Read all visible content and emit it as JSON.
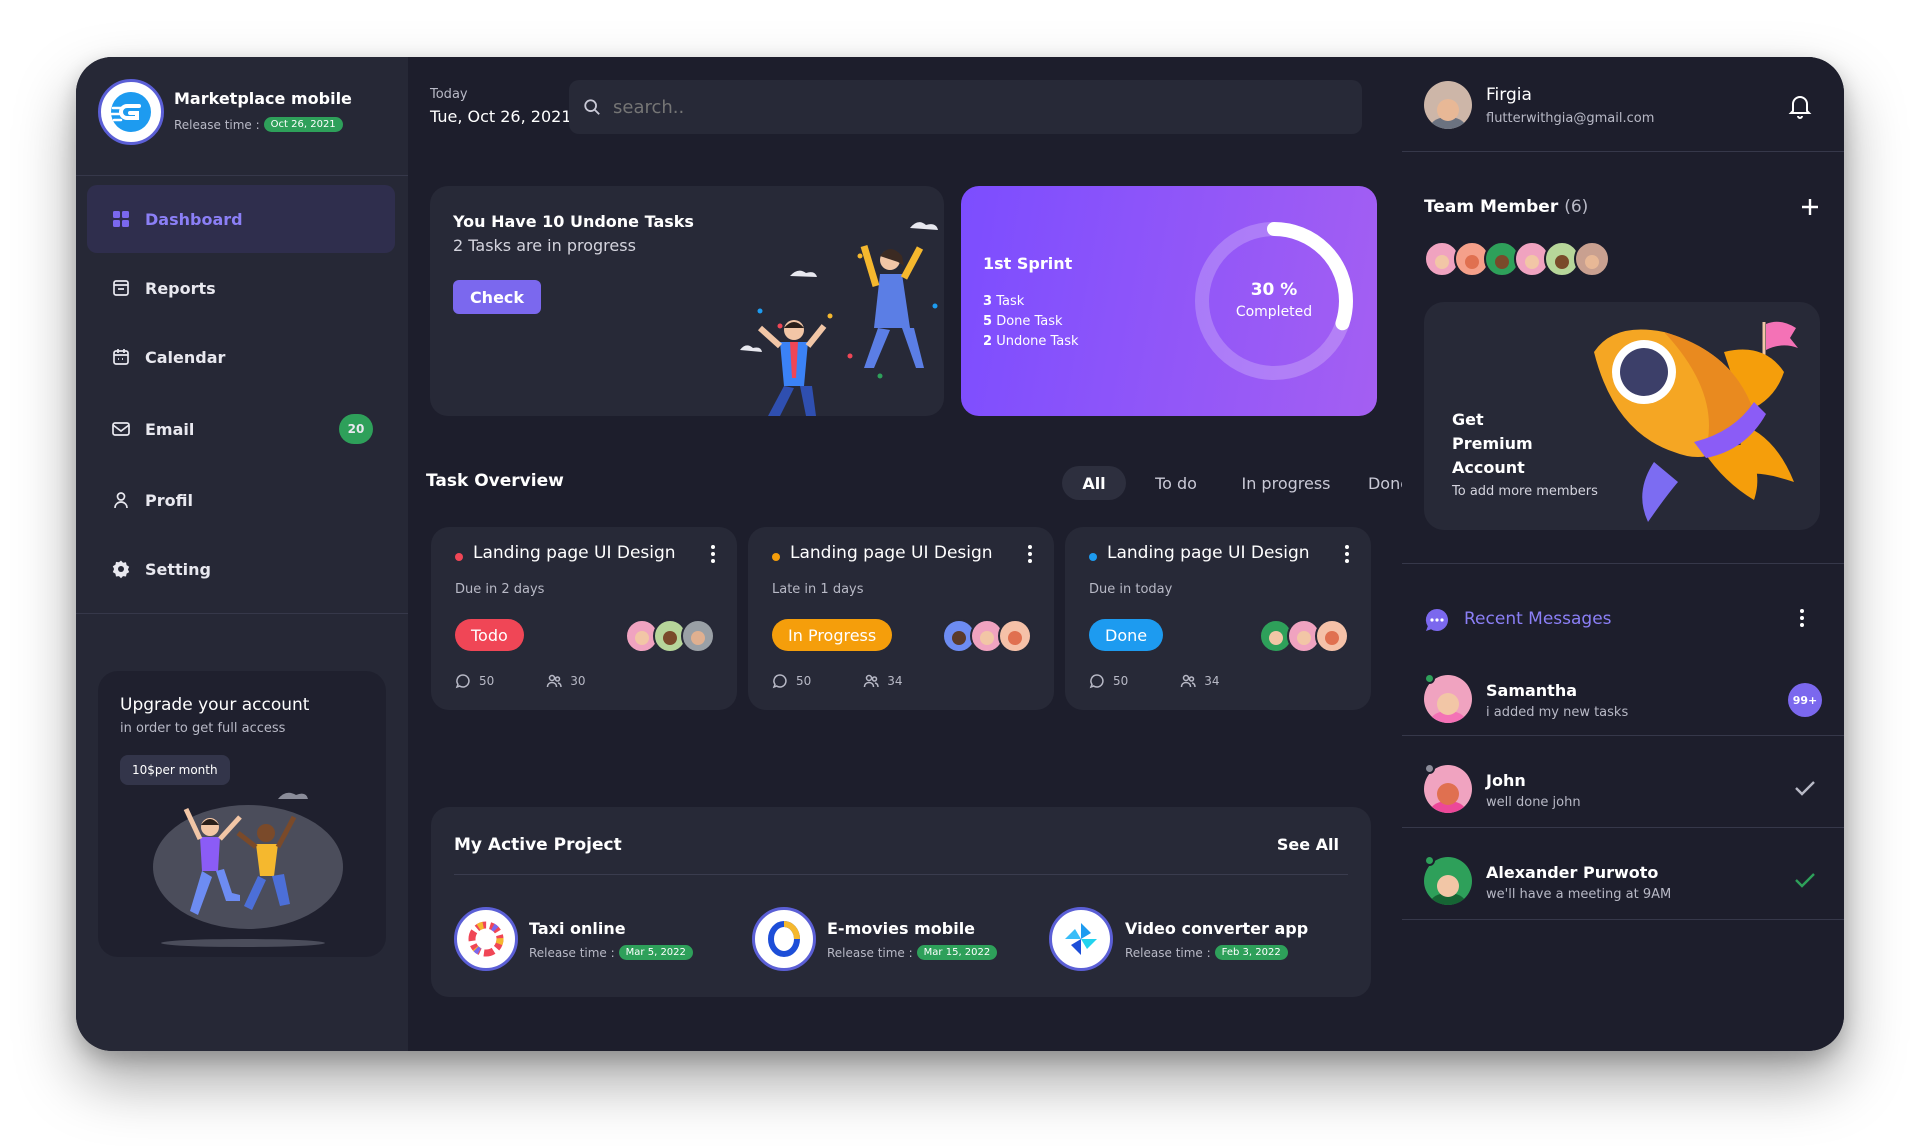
{
  "project": {
    "name": "Marketplace mobile",
    "release_label": "Release time :",
    "release_date": "Oct 26, 2021"
  },
  "nav": [
    {
      "label": "Dashboard",
      "icon": "grid-icon",
      "active": true
    },
    {
      "label": "Reports",
      "icon": "report-icon"
    },
    {
      "label": "Calendar",
      "icon": "calendar-icon"
    },
    {
      "label": "Email",
      "icon": "mail-icon",
      "badge": "20"
    },
    {
      "label": "Profil",
      "icon": "user-icon"
    },
    {
      "label": "Setting",
      "icon": "gear-icon"
    }
  ],
  "upgrade": {
    "title": "Upgrade your account",
    "subtitle": "in order to get full access",
    "price": "10$per month"
  },
  "header": {
    "today_label": "Today",
    "date": "Tue, Oct 26, 2021",
    "search_placeholder": "search.."
  },
  "tasks_banner": {
    "title": "You Have 10 Undone Tasks",
    "subtitle": "2 Tasks are in progress",
    "button": "Check"
  },
  "sprint": {
    "title": "1st Sprint",
    "tasks": [
      {
        "n": "3",
        "label": "Task"
      },
      {
        "n": "5",
        "label": "Done Task"
      },
      {
        "n": "2",
        "label": "Undone Task"
      }
    ],
    "percent": "30 %",
    "percent_value": 30,
    "completed_label": "Completed"
  },
  "overview": {
    "title": "Task Overview",
    "tabs": [
      "All",
      "To do",
      "In progress",
      "Done"
    ],
    "cards": [
      {
        "title": "Landing page UI Design",
        "due": "Due in 2 days",
        "status": "Todo",
        "status_color": "#f04656",
        "dot_color": "#f04656",
        "comments": "50",
        "members": "30"
      },
      {
        "title": "Landing page UI Design",
        "due": "Late in 1 days",
        "status": "In Progress",
        "status_color": "#f59e0b",
        "dot_color": "#f59e0b",
        "comments": "50",
        "members": "34"
      },
      {
        "title": "Landing page UI Design",
        "due": "Due in today",
        "status": "Done",
        "status_color": "#1d9bf0",
        "dot_color": "#1d9bf0",
        "comments": "50",
        "members": "34"
      }
    ]
  },
  "projects": {
    "title": "My Active Project",
    "see_all": "See All",
    "items": [
      {
        "name": "Taxi online",
        "release_label": "Release time :",
        "date": "Mar 5, 2022"
      },
      {
        "name": "E-movies mobile",
        "release_label": "Release time :",
        "date": "Mar 15, 2022"
      },
      {
        "name": "Video converter app",
        "release_label": "Release time :",
        "date": "Feb 3, 2022"
      }
    ]
  },
  "user": {
    "name": "Firgia",
    "email": "flutterwithgia@gmail.com"
  },
  "team": {
    "title": "Team Member",
    "count": "(6)"
  },
  "premium": {
    "line1": "Get",
    "line2": "Premium",
    "line3": "Account",
    "subtitle": "To add more members"
  },
  "messages": {
    "title": "Recent Messages",
    "items": [
      {
        "name": "Samantha",
        "text": "i added my new tasks",
        "badge": "99+"
      },
      {
        "name": "John",
        "text": "well done john"
      },
      {
        "name": "Alexander Purwoto",
        "text": "we'll have a meeting at 9AM"
      }
    ]
  },
  "colors": {
    "accent": "#7b68ee",
    "green": "#2ea05a",
    "background": "#1d1e2c",
    "panel": "#262836"
  }
}
